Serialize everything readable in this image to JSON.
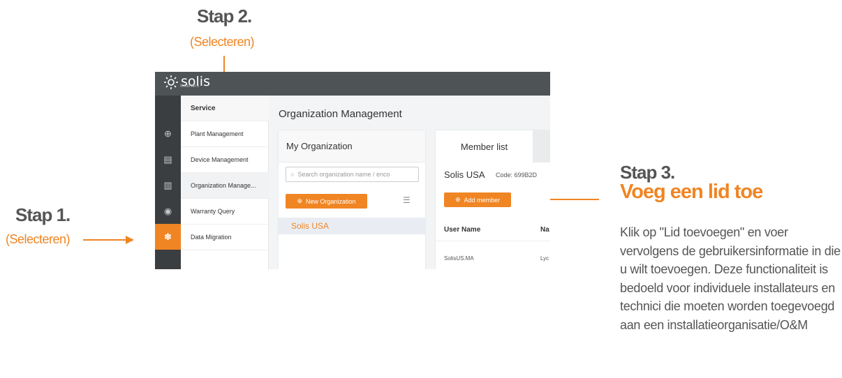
{
  "annotations": {
    "step1": {
      "title": "Stap 1.",
      "subtitle": "(Selecteren)"
    },
    "step2": {
      "title": "Stap 2.",
      "subtitle": "(Selecteren)"
    },
    "step3": {
      "title": "Stap 3.",
      "heading": "Voeg een lid toe",
      "body": "Klik op \"Lid toevoegen\" en voer vervolgens de gebruikersinformatie in die u wilt toevoegen. Deze functionaliteit is bedoeld voor individuele installateurs en technici die moeten worden toegevoegd aan een installatieorganisatie/O&M"
    },
    "accent_color": "#f08524"
  },
  "app": {
    "logo": {
      "text": "solis",
      "subtext": "inverters"
    },
    "iconbar": [
      {
        "icon": "plant-icon",
        "glyph": "⊕"
      },
      {
        "icon": "device-icon",
        "glyph": "▤"
      },
      {
        "icon": "chart-icon",
        "glyph": "▥"
      },
      {
        "icon": "eye-icon",
        "glyph": "◉"
      },
      {
        "icon": "service-icon",
        "glyph": "✽"
      }
    ],
    "menu": {
      "header": "Service",
      "items": [
        {
          "label": "Plant Management"
        },
        {
          "label": "Device Management"
        },
        {
          "label": "Organization Manage..."
        },
        {
          "label": "Warranty Query"
        },
        {
          "label": "Data Migration"
        }
      ]
    },
    "page_title": "Organization Management",
    "my_org": {
      "title": "My Organization",
      "search_placeholder": "Search organization name / enco",
      "new_button": "New Organization",
      "rows": [
        "Solis USA"
      ]
    },
    "member_list": {
      "tab": "Member list",
      "org_name": "Solis USA",
      "code": "Code: 699B2D",
      "add_button": "Add member",
      "columns": {
        "username": "User Name",
        "name": "Na"
      },
      "rows": [
        {
          "username": "SolisUS.MA",
          "name": "Lyc"
        }
      ]
    }
  }
}
